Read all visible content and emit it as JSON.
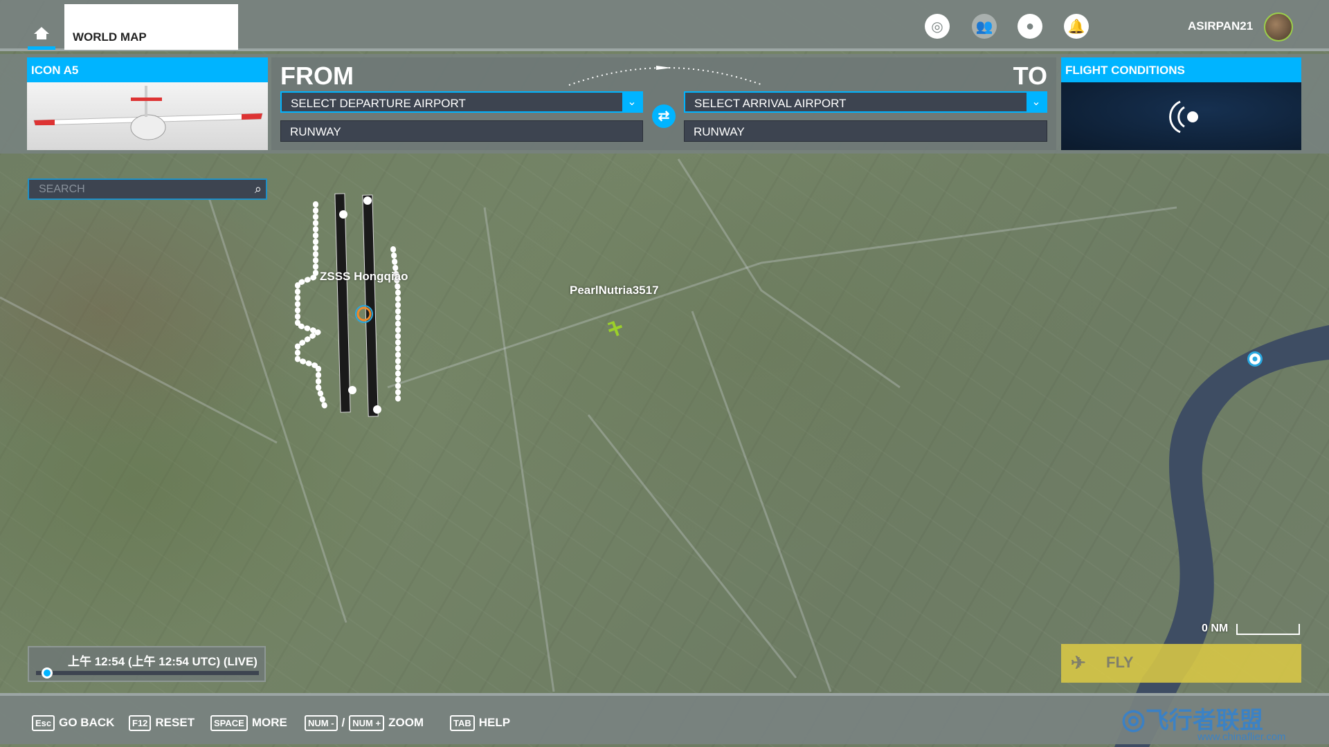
{
  "topbar": {
    "tab_label": "WORLD MAP",
    "username": "ASIRPAN21",
    "icons": [
      "home-icon",
      "activity-icon",
      "friends-icon",
      "profile-icon",
      "notification-bell-icon"
    ]
  },
  "aircraft": {
    "title": "ICON A5"
  },
  "route": {
    "from_label": "FROM",
    "to_label": "TO",
    "departure_placeholder": "SELECT DEPARTURE AIRPORT",
    "arrival_placeholder": "SELECT ARRIVAL AIRPORT",
    "departure_runway": "RUNWAY",
    "arrival_runway": "RUNWAY"
  },
  "conditions": {
    "title": "FLIGHT CONDITIONS"
  },
  "search": {
    "placeholder": "SEARCH"
  },
  "map": {
    "airport_label": "ZSSS Hongqiao",
    "aircraft_label": "PearlNutria3517",
    "scale_label": "0 NM"
  },
  "time": {
    "text": "上午 12:54 (上午 12:54 UTC) (LIVE)",
    "slider_fraction": 0.05
  },
  "fly": {
    "label": "FLY"
  },
  "bottom": [
    {
      "key": "Esc",
      "label": "GO BACK"
    },
    {
      "key": "F12",
      "label": "RESET"
    },
    {
      "key": "SPACE",
      "label": "MORE"
    },
    {
      "key": "NUM -",
      "sep": "/",
      "key2": "NUM +",
      "label": "ZOOM"
    },
    {
      "key": "TAB",
      "label": "HELP"
    }
  ],
  "watermark": {
    "text": "飞行者联盟",
    "url_text": "www.chinaflier.com"
  },
  "colors": {
    "accent": "#00b4ff",
    "fly": "#dac846",
    "aircraft_marker": "#9bd02a"
  }
}
